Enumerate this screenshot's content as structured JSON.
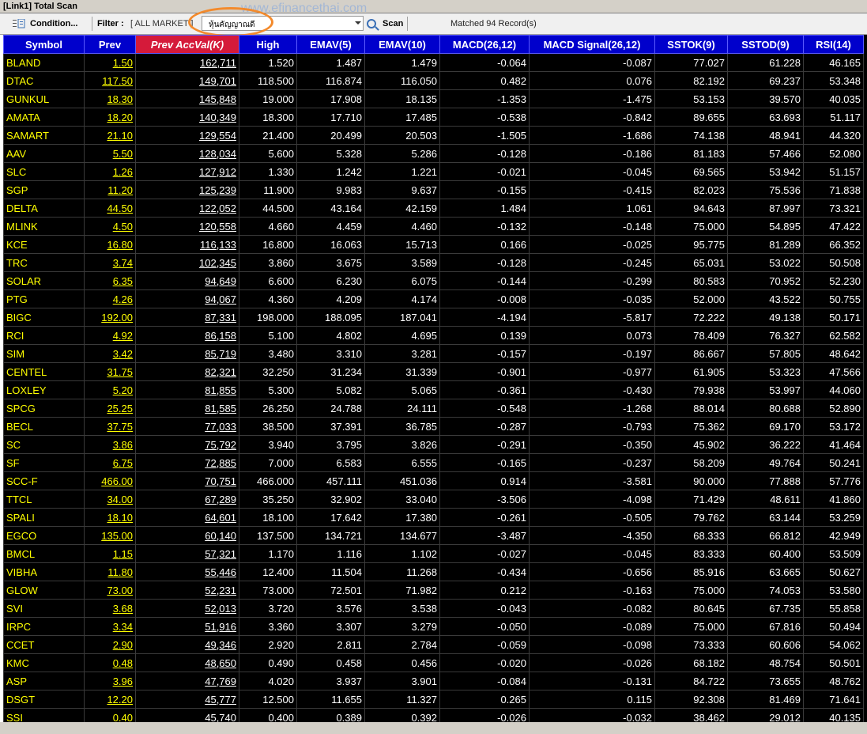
{
  "window": {
    "title": "[Link1] Total Scan"
  },
  "toolbar": {
    "condition_label": "Condition...",
    "filter_label": "Filter :",
    "filter_value": "[ ALL MARKET ]",
    "combo_value": "หุ้นคัญญาณดี",
    "scan_label": "Scan",
    "matched_text": "Matched 94 Record(s)",
    "watermark": "www.efinancethai.com"
  },
  "table": {
    "headers": [
      "Symbol",
      "Prev",
      "Prev AccVal(K)",
      "High",
      "EMAV(5)",
      "EMAV(10)",
      "MACD(26,12)",
      "MACD Signal(26,12)",
      "SSTOK(9)",
      "SSTOD(9)",
      "RSI(14)"
    ],
    "rows": [
      [
        "BLAND",
        "1.50",
        "162,711",
        "1.520",
        "1.487",
        "1.479",
        "-0.064",
        "-0.087",
        "77.027",
        "61.228",
        "46.165"
      ],
      [
        "DTAC",
        "117.50",
        "149,701",
        "118.500",
        "116.874",
        "116.050",
        "0.482",
        "0.076",
        "82.192",
        "69.237",
        "53.348"
      ],
      [
        "GUNKUL",
        "18.30",
        "145,848",
        "19.000",
        "17.908",
        "18.135",
        "-1.353",
        "-1.475",
        "53.153",
        "39.570",
        "40.035"
      ],
      [
        "AMATA",
        "18.20",
        "140,349",
        "18.300",
        "17.710",
        "17.485",
        "-0.538",
        "-0.842",
        "89.655",
        "63.693",
        "51.117"
      ],
      [
        "SAMART",
        "21.10",
        "129,554",
        "21.400",
        "20.499",
        "20.503",
        "-1.505",
        "-1.686",
        "74.138",
        "48.941",
        "44.320"
      ],
      [
        "AAV",
        "5.50",
        "128,034",
        "5.600",
        "5.328",
        "5.286",
        "-0.128",
        "-0.186",
        "81.183",
        "57.466",
        "52.080"
      ],
      [
        "SLC",
        "1.26",
        "127,912",
        "1.330",
        "1.242",
        "1.221",
        "-0.021",
        "-0.045",
        "69.565",
        "53.942",
        "51.157"
      ],
      [
        "SGP",
        "11.20",
        "125,239",
        "11.900",
        "9.983",
        "9.637",
        "-0.155",
        "-0.415",
        "82.023",
        "75.536",
        "71.838"
      ],
      [
        "DELTA",
        "44.50",
        "122,052",
        "44.500",
        "43.164",
        "42.159",
        "1.484",
        "1.061",
        "94.643",
        "87.997",
        "73.321"
      ],
      [
        "MLINK",
        "4.50",
        "120,558",
        "4.660",
        "4.459",
        "4.460",
        "-0.132",
        "-0.148",
        "75.000",
        "54.895",
        "47.422"
      ],
      [
        "KCE",
        "16.80",
        "116,133",
        "16.800",
        "16.063",
        "15.713",
        "0.166",
        "-0.025",
        "95.775",
        "81.289",
        "66.352"
      ],
      [
        "TRC",
        "3.74",
        "102,345",
        "3.860",
        "3.675",
        "3.589",
        "-0.128",
        "-0.245",
        "65.031",
        "53.022",
        "50.508"
      ],
      [
        "SOLAR",
        "6.35",
        "94,649",
        "6.600",
        "6.230",
        "6.075",
        "-0.144",
        "-0.299",
        "80.583",
        "70.952",
        "52.230"
      ],
      [
        "PTG",
        "4.26",
        "94,067",
        "4.360",
        "4.209",
        "4.174",
        "-0.008",
        "-0.035",
        "52.000",
        "43.522",
        "50.755"
      ],
      [
        "BIGC",
        "192.00",
        "87,331",
        "198.000",
        "188.095",
        "187.041",
        "-4.194",
        "-5.817",
        "72.222",
        "49.138",
        "50.171"
      ],
      [
        "RCI",
        "4.92",
        "86,158",
        "5.100",
        "4.802",
        "4.695",
        "0.139",
        "0.073",
        "78.409",
        "76.327",
        "62.582"
      ],
      [
        "SIM",
        "3.42",
        "85,719",
        "3.480",
        "3.310",
        "3.281",
        "-0.157",
        "-0.197",
        "86.667",
        "57.805",
        "48.642"
      ],
      [
        "CENTEL",
        "31.75",
        "82,321",
        "32.250",
        "31.234",
        "31.339",
        "-0.901",
        "-0.977",
        "61.905",
        "53.323",
        "47.566"
      ],
      [
        "LOXLEY",
        "5.20",
        "81,855",
        "5.300",
        "5.082",
        "5.065",
        "-0.361",
        "-0.430",
        "79.938",
        "53.997",
        "44.060"
      ],
      [
        "SPCG",
        "25.25",
        "81,585",
        "26.250",
        "24.788",
        "24.111",
        "-0.548",
        "-1.268",
        "88.014",
        "80.688",
        "52.890"
      ],
      [
        "BECL",
        "37.75",
        "77,033",
        "38.500",
        "37.391",
        "36.785",
        "-0.287",
        "-0.793",
        "75.362",
        "69.170",
        "53.172"
      ],
      [
        "SC",
        "3.86",
        "75,792",
        "3.940",
        "3.795",
        "3.826",
        "-0.291",
        "-0.350",
        "45.902",
        "36.222",
        "41.464"
      ],
      [
        "SF",
        "6.75",
        "72,885",
        "7.000",
        "6.583",
        "6.555",
        "-0.165",
        "-0.237",
        "58.209",
        "49.764",
        "50.241"
      ],
      [
        "SCC-F",
        "466.00",
        "70,751",
        "466.000",
        "457.111",
        "451.036",
        "0.914",
        "-3.581",
        "90.000",
        "77.888",
        "57.776"
      ],
      [
        "TTCL",
        "34.00",
        "67,289",
        "35.250",
        "32.902",
        "33.040",
        "-3.506",
        "-4.098",
        "71.429",
        "48.611",
        "41.860"
      ],
      [
        "SPALI",
        "18.10",
        "64,601",
        "18.100",
        "17.642",
        "17.380",
        "-0.261",
        "-0.505",
        "79.762",
        "63.144",
        "53.259"
      ],
      [
        "EGCO",
        "135.00",
        "60,140",
        "137.500",
        "134.721",
        "134.677",
        "-3.487",
        "-4.350",
        "68.333",
        "66.812",
        "42.949"
      ],
      [
        "BMCL",
        "1.15",
        "57,321",
        "1.170",
        "1.116",
        "1.102",
        "-0.027",
        "-0.045",
        "83.333",
        "60.400",
        "53.509"
      ],
      [
        "VIBHA",
        "11.80",
        "55,446",
        "12.400",
        "11.504",
        "11.268",
        "-0.434",
        "-0.656",
        "85.916",
        "63.665",
        "50.627"
      ],
      [
        "GLOW",
        "73.00",
        "52,231",
        "73.000",
        "72.501",
        "71.982",
        "0.212",
        "-0.163",
        "75.000",
        "74.053",
        "53.580"
      ],
      [
        "SVI",
        "3.68",
        "52,013",
        "3.720",
        "3.576",
        "3.538",
        "-0.043",
        "-0.082",
        "80.645",
        "67.735",
        "55.858"
      ],
      [
        "IRPC",
        "3.34",
        "51,916",
        "3.360",
        "3.307",
        "3.279",
        "-0.050",
        "-0.089",
        "75.000",
        "67.816",
        "50.494"
      ],
      [
        "CCET",
        "2.90",
        "49,346",
        "2.920",
        "2.811",
        "2.784",
        "-0.059",
        "-0.098",
        "73.333",
        "60.606",
        "54.062"
      ],
      [
        "KMC",
        "0.48",
        "48,650",
        "0.490",
        "0.458",
        "0.456",
        "-0.020",
        "-0.026",
        "68.182",
        "48.754",
        "50.501"
      ],
      [
        "ASP",
        "3.96",
        "47,769",
        "4.020",
        "3.937",
        "3.901",
        "-0.084",
        "-0.131",
        "84.722",
        "73.655",
        "48.762"
      ],
      [
        "DSGT",
        "12.20",
        "45,777",
        "12.500",
        "11.655",
        "11.327",
        "0.265",
        "0.115",
        "92.308",
        "81.469",
        "71.641"
      ],
      [
        "SSI",
        "0.40",
        "45,740",
        "0.400",
        "0.389",
        "0.392",
        "-0.026",
        "-0.032",
        "38.462",
        "29.012",
        "40.135"
      ]
    ]
  }
}
